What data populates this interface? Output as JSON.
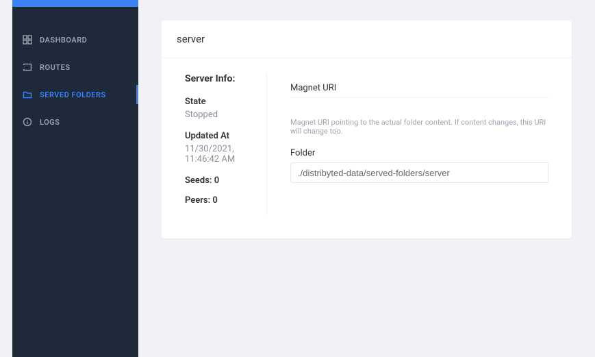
{
  "sidebar": {
    "items": [
      {
        "label": "DASHBOARD"
      },
      {
        "label": "ROUTES"
      },
      {
        "label": "SERVED FOLDERS"
      },
      {
        "label": "LOGS"
      }
    ]
  },
  "page": {
    "title": "server"
  },
  "server_info": {
    "heading": "Server Info:",
    "state_label": "State",
    "state_value": "Stopped",
    "updated_at_label": "Updated At",
    "updated_at_value": "11/30/2021, 11:46:42 AM",
    "seeds_label": "Seeds: 0",
    "peers_label": "Peers: 0"
  },
  "form": {
    "magnet_label": "Magnet URI",
    "magnet_value": "",
    "magnet_hint": "Magnet URI pointing to the actual folder content. If content changes, this URI will change too.",
    "folder_label": "Folder",
    "folder_value": "./distribyted-data/served-folders/server"
  }
}
